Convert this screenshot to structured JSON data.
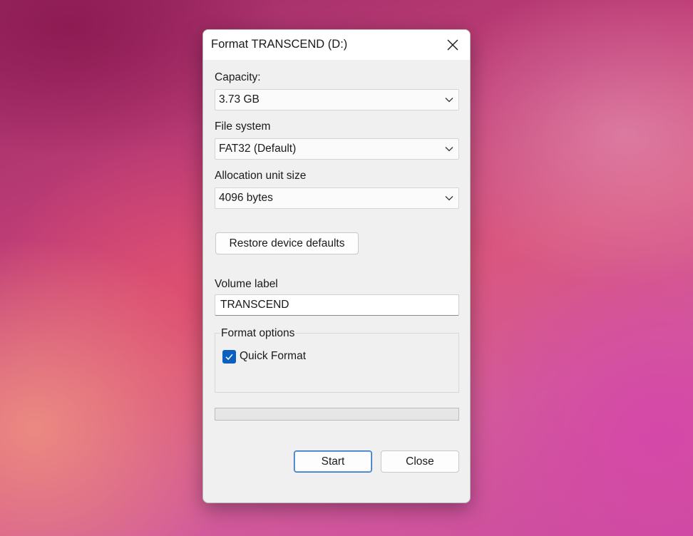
{
  "dialog": {
    "title": "Format TRANSCEND (D:)",
    "close_icon": "close-icon"
  },
  "capacity": {
    "label": "Capacity:",
    "value": "3.73 GB"
  },
  "file_system": {
    "label": "File system",
    "value": "FAT32 (Default)"
  },
  "allocation": {
    "label": "Allocation unit size",
    "value": "4096 bytes"
  },
  "restore_button": "Restore device defaults",
  "volume_label": {
    "label": "Volume label",
    "value": "TRANSCEND"
  },
  "format_options": {
    "title": "Format options",
    "quick_format": {
      "label": "Quick Format",
      "checked": true
    }
  },
  "progress": {
    "fraction": 0
  },
  "buttons": {
    "start": "Start",
    "close": "Close"
  },
  "colors": {
    "accent": "#0a5fbf",
    "dialog_bg": "#f0f0f0",
    "progress_fill": "#06b025"
  }
}
